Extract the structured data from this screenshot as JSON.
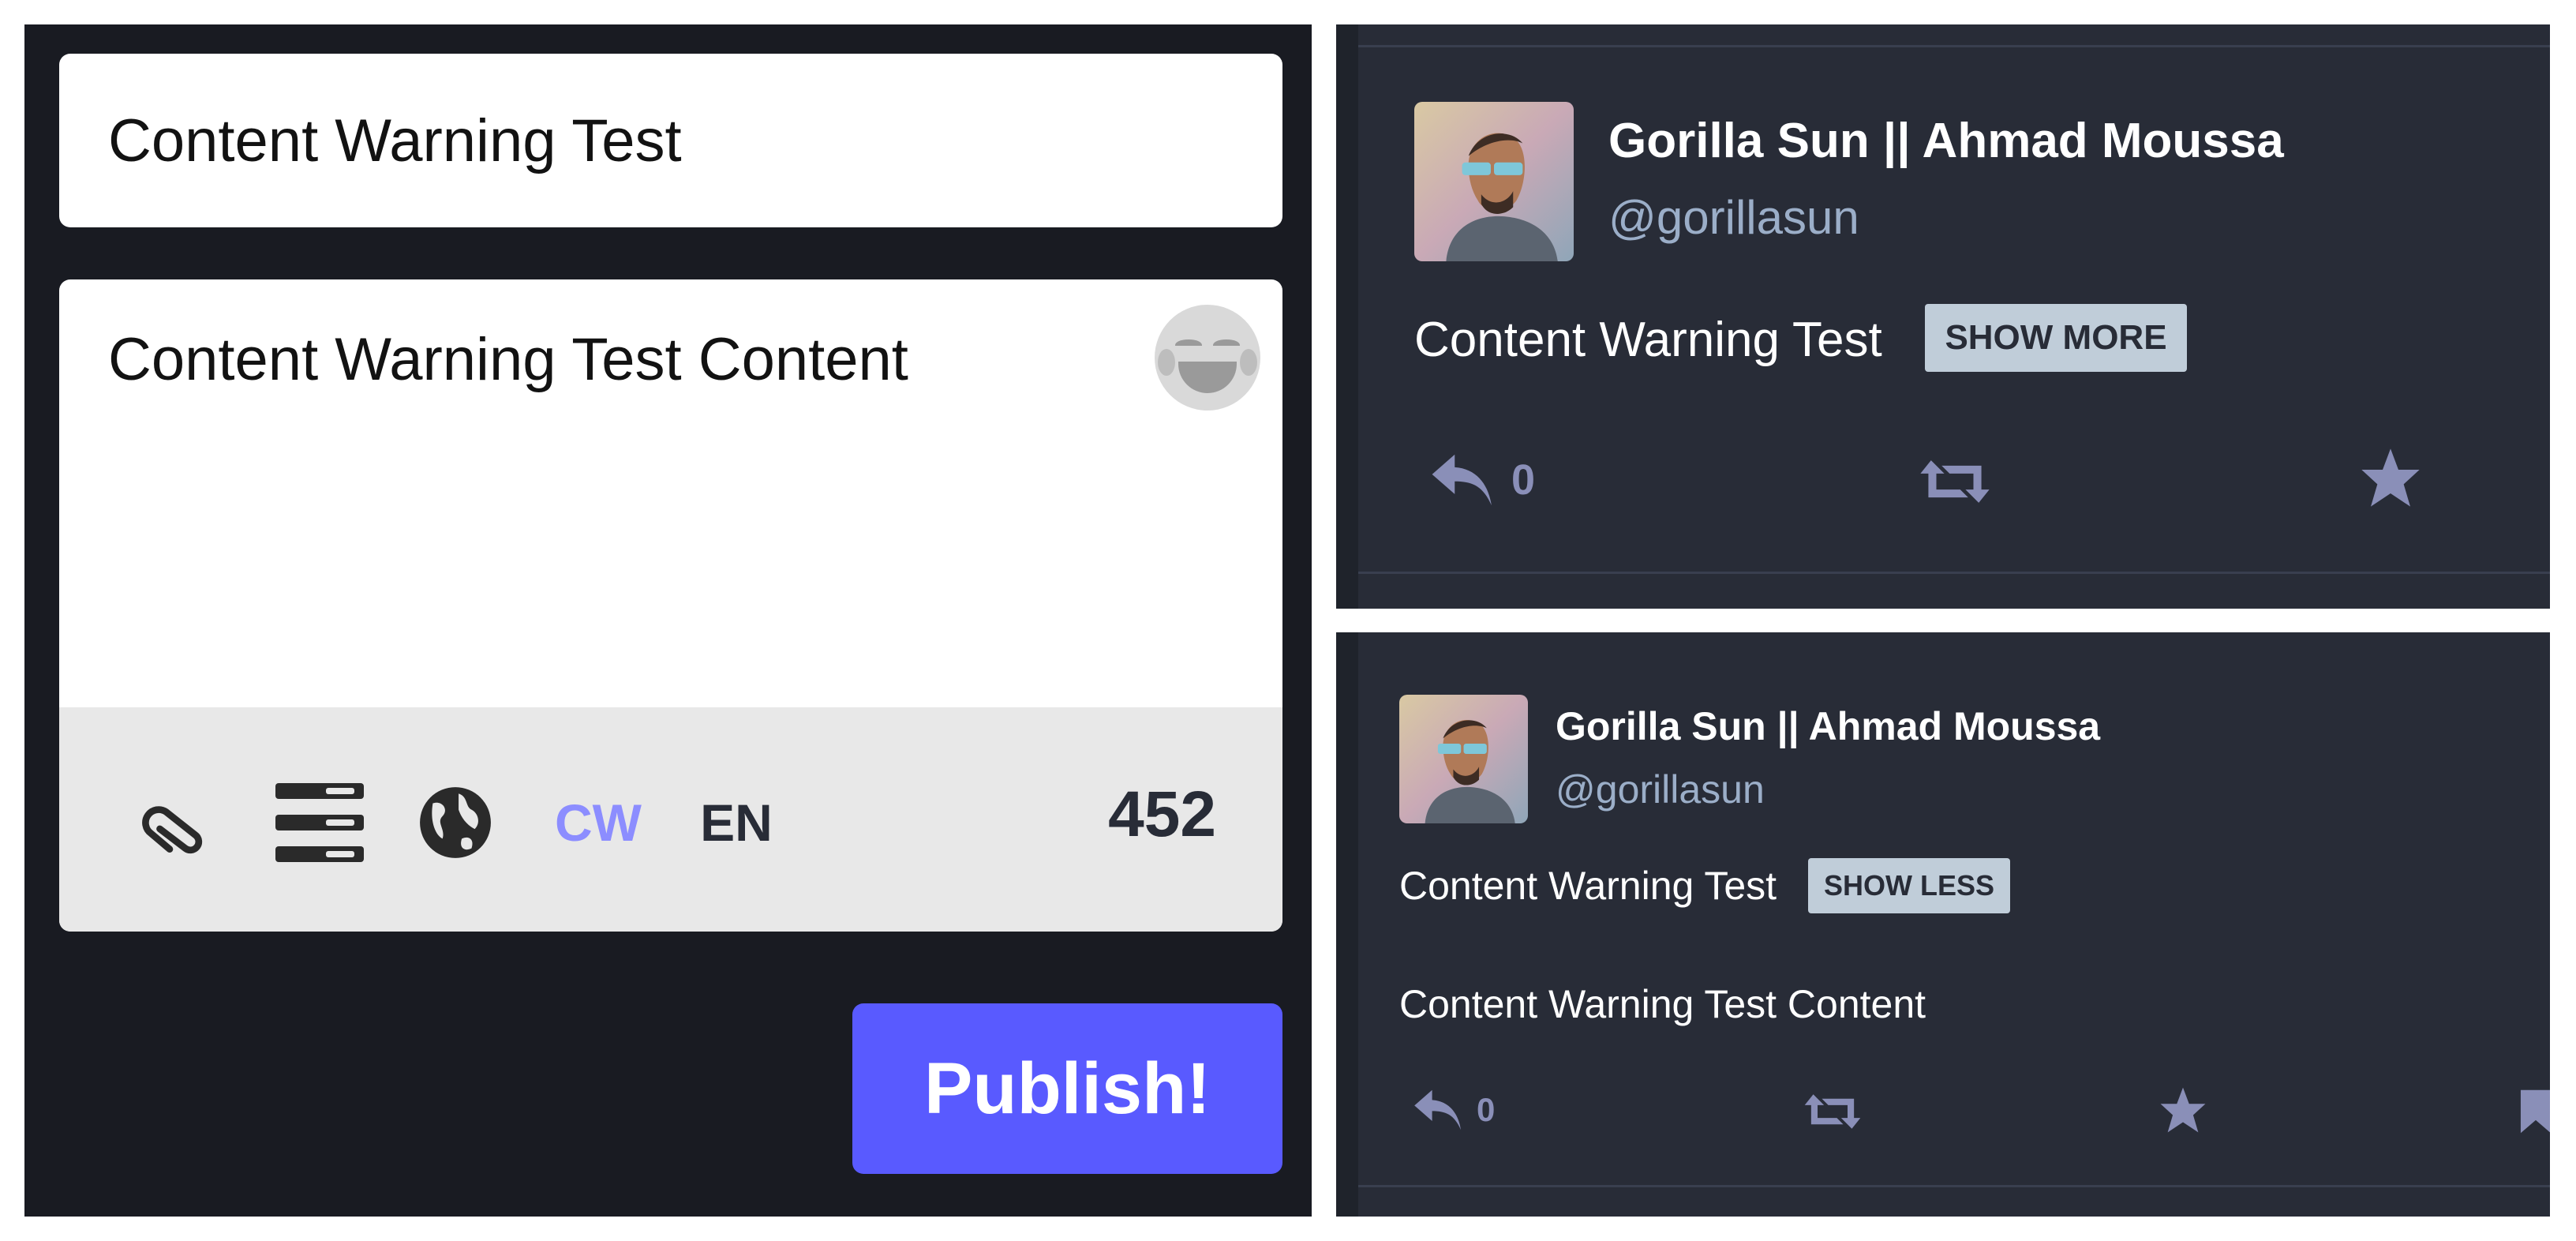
{
  "compose": {
    "cw_value": "Content Warning Test",
    "text_value": "Content Warning Test Content",
    "emoji_button": "emoji-picker-icon",
    "toolbar": {
      "attach_icon": "paperclip-icon",
      "poll_icon": "poll-icon",
      "visibility_icon": "globe-icon",
      "cw_label": "CW",
      "language_label": "EN",
      "char_count": "452"
    },
    "publish_label": "Publish!",
    "colors": {
      "accent": "#595aff",
      "cw_active": "#8c8dff",
      "background": "#191b22"
    }
  },
  "statuses": [
    {
      "display_name": "Gorilla Sun || Ahmad Moussa",
      "handle": "@gorillasun",
      "spoiler_text": "Content Warning Test",
      "toggle_label": "SHOW MORE",
      "reply_count": "0"
    },
    {
      "display_name": "Gorilla Sun || Ahmad Moussa",
      "handle": "@gorillasun",
      "spoiler_text": "Content Warning Test",
      "toggle_label": "SHOW LESS",
      "content": "Content Warning Test Content",
      "reply_count": "0"
    }
  ]
}
